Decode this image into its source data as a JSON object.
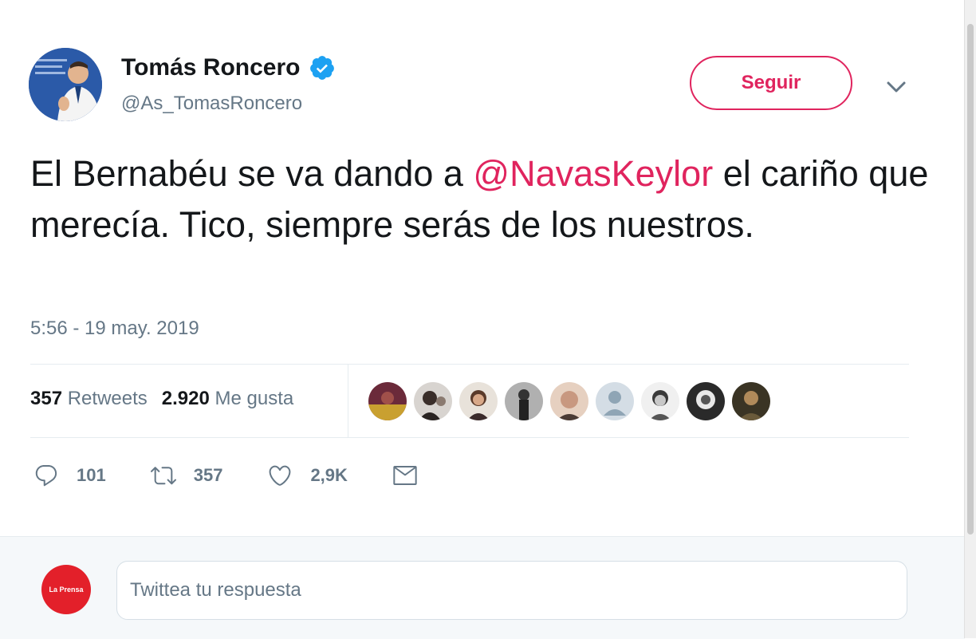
{
  "author": {
    "name": "Tomás Roncero",
    "handle": "@As_TomasRoncero",
    "verified": true
  },
  "follow_button": {
    "label": "Seguir",
    "color": "#e0245e"
  },
  "tweet": {
    "text_before": "El Bernabéu se va dando a ",
    "mention": "@NavasKeylor",
    "text_after": " el cariño que merecía. Tico, siempre serás de los nuestros.",
    "timestamp": "5:56 - 19 may. 2019"
  },
  "stats": {
    "retweets_count": "357",
    "retweets_label": "Retweets",
    "likes_count": "2.920",
    "likes_label": "Me gusta"
  },
  "liker_avatars": [
    {
      "name": "liker-1"
    },
    {
      "name": "liker-2"
    },
    {
      "name": "liker-3"
    },
    {
      "name": "liker-4"
    },
    {
      "name": "liker-5"
    },
    {
      "name": "liker-6"
    },
    {
      "name": "liker-7"
    },
    {
      "name": "liker-8"
    },
    {
      "name": "liker-9"
    }
  ],
  "actions": {
    "replies": "101",
    "retweets": "357",
    "likes": "2,9K"
  },
  "reply": {
    "avatar_label": "La Prensa",
    "placeholder": "Twittea tu respuesta"
  },
  "colors": {
    "accent": "#e0245e",
    "verified": "#1da1f2",
    "muted": "#657786",
    "text": "#14171a"
  }
}
